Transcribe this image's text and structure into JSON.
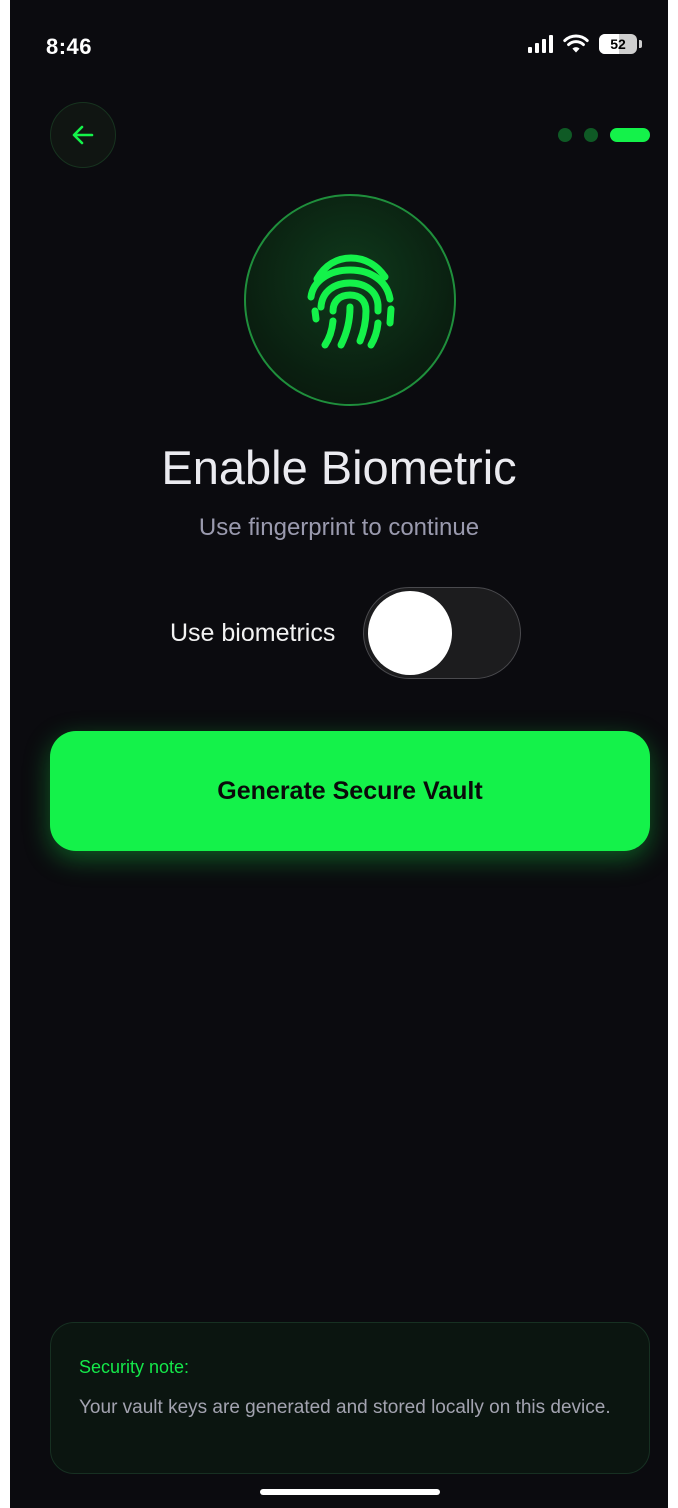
{
  "status_bar": {
    "time": "8:46",
    "battery": "52"
  },
  "header": {
    "back_icon": "arrow-left-icon",
    "progress_steps": 3,
    "active_step": 3
  },
  "hero": {
    "icon": "fingerprint-icon",
    "title": "Enable Biometric",
    "subtitle": "Use fingerprint to continue"
  },
  "biometrics": {
    "label": "Use biometrics",
    "enabled": false
  },
  "primary_action": {
    "label": "Generate Secure Vault"
  },
  "security_note": {
    "title": "Security note:",
    "body": "Your vault keys are generated and stored locally on this device."
  },
  "colors": {
    "accent": "#14f24a",
    "background": "#0b0b0f"
  }
}
